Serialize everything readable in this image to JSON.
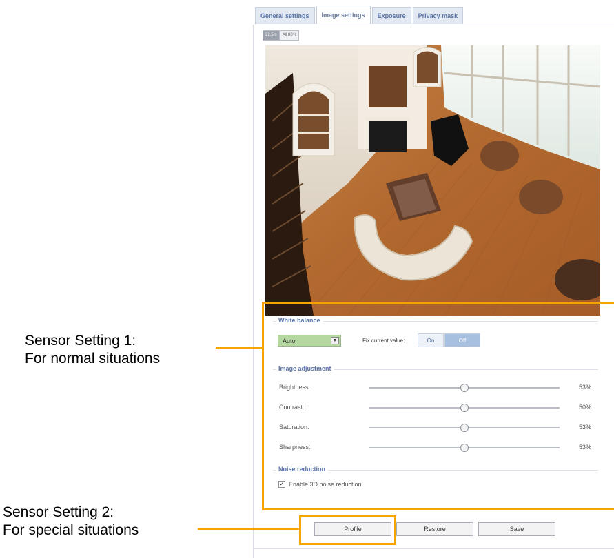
{
  "tabs": [
    {
      "label": "General settings",
      "active": false
    },
    {
      "label": "Image settings",
      "active": true
    },
    {
      "label": "Exposure",
      "active": false
    },
    {
      "label": "Privacy mask",
      "active": false
    }
  ],
  "view_size": {
    "options": [
      "22.5m",
      "All 80%"
    ],
    "selected": "22.5m"
  },
  "callouts": {
    "sensor1_line1": "Sensor Setting 1:",
    "sensor1_line2": "For normal situations",
    "sensor2_line1": "Sensor Setting 2:",
    "sensor2_line2": "For special situations"
  },
  "white_balance": {
    "title": "White balance",
    "mode": "Auto",
    "fix_label": "Fix current value:",
    "on_label": "On",
    "off_label": "Off",
    "selected": "Off"
  },
  "image_adjustment": {
    "title": "Image adjustment",
    "sliders": [
      {
        "label": "Brightness:",
        "value": "53%",
        "level": 0.5
      },
      {
        "label": "Contrast:",
        "value": "50%",
        "level": 0.5
      },
      {
        "label": "Saturation:",
        "value": "53%",
        "level": 0.5
      },
      {
        "label": "Sharpness:",
        "value": "53%",
        "level": 0.5
      }
    ]
  },
  "noise_reduction": {
    "title": "Noise reduction",
    "checkbox_label": "Enable 3D noise reduction",
    "checked": true
  },
  "buttons": {
    "profile": "Profile",
    "restore": "Restore",
    "save": "Save"
  },
  "colors": {
    "highlight": "#f5a400",
    "accent": "#5a74a8"
  }
}
